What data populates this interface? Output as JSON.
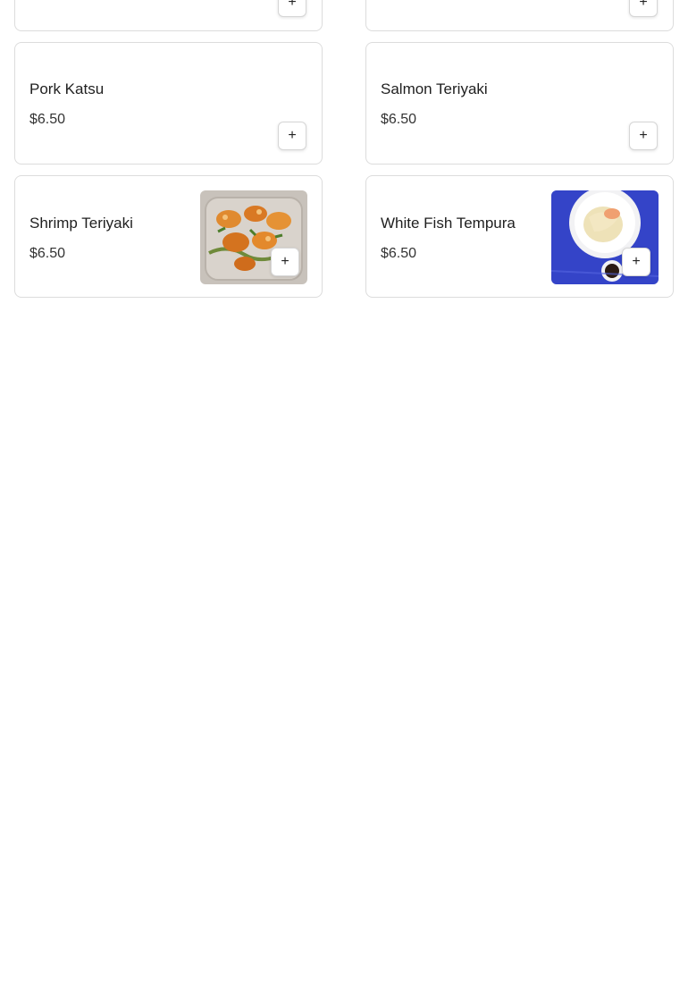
{
  "menu": {
    "items": [
      {
        "name": "",
        "price": "",
        "add_icon": "plus-icon"
      },
      {
        "name": "",
        "price": "",
        "add_icon": "plus-icon"
      },
      {
        "name": "Pork Katsu",
        "price": "$6.50",
        "add_icon": "plus-icon"
      },
      {
        "name": "Salmon Teriyaki",
        "price": "$6.50",
        "add_icon": "plus-icon"
      },
      {
        "name": "Shrimp Teriyaki",
        "price": "$6.50",
        "add_icon": "plus-icon",
        "image": "shrimp-teriyaki-photo"
      },
      {
        "name": "White Fish Tempura",
        "price": "$6.50",
        "add_icon": "plus-icon",
        "image": "white-fish-tempura-photo"
      }
    ],
    "plus_glyph": "+"
  }
}
